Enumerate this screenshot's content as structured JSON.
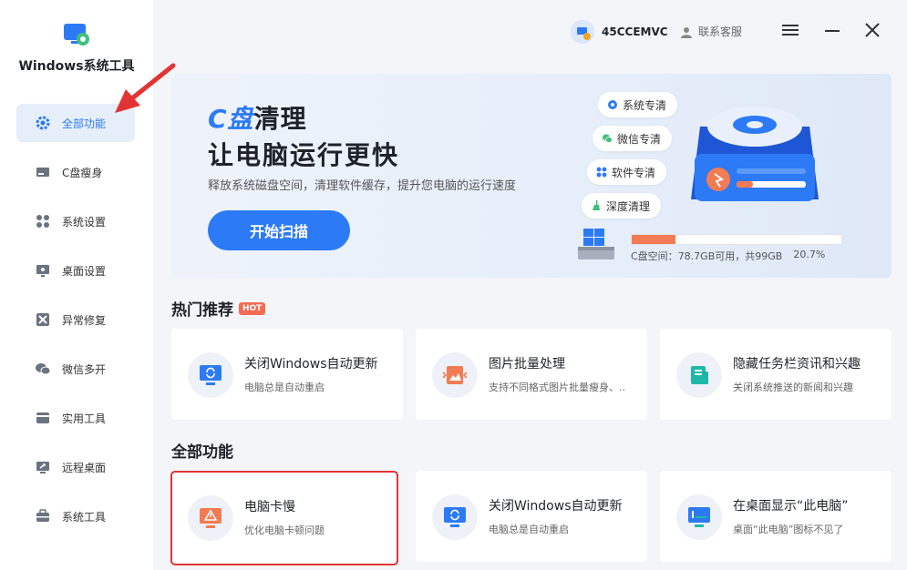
{
  "app": {
    "title": "Windows系统工具"
  },
  "sidebar": {
    "items": [
      {
        "label": "全部功能",
        "icon": "gear-icon",
        "active": true
      },
      {
        "label": "C盘瘦身",
        "icon": "disk-icon"
      },
      {
        "label": "系统设置",
        "icon": "grid-icon"
      },
      {
        "label": "桌面设置",
        "icon": "desktop-icon"
      },
      {
        "label": "异常修复",
        "icon": "tools-icon"
      },
      {
        "label": "微信多开",
        "icon": "wechat-icon"
      },
      {
        "label": "实用工具",
        "icon": "box-icon"
      },
      {
        "label": "远程桌面",
        "icon": "remote-icon"
      },
      {
        "label": "系统工具",
        "icon": "briefcase-icon"
      }
    ]
  },
  "header": {
    "username": "45CCEMVC",
    "service_label": "联系客服"
  },
  "banner": {
    "title_c": "C盘",
    "title_rest": "清理",
    "title_line2": "让电脑运行更快",
    "subtitle": "释放系统磁盘空间，清理软件缓存，提升您电脑的运行速度",
    "button": "开始扫描",
    "pills": [
      "系统专清",
      "微信专清",
      "软件专清",
      "深度清理"
    ],
    "cdrive": {
      "label": "C盘空间：",
      "info": "78.7GB可用，共99GB",
      "percent_text": "20.7%",
      "used_fraction": 0.207
    }
  },
  "hot": {
    "heading": "热门推荐",
    "badge": "HOT",
    "cards": [
      {
        "title": "关闭Windows自动更新",
        "desc": "电脑总是自动重启"
      },
      {
        "title": "图片批量处理",
        "desc": "支持不同格式图片批量瘦身、.."
      },
      {
        "title": "隐藏任务栏资讯和兴趣",
        "desc": "关闭系统推送的新闻和兴趣"
      }
    ]
  },
  "all": {
    "heading": "全部功能",
    "cards": [
      {
        "title": "电脑卡慢",
        "desc": "优化电脑卡顿问题"
      },
      {
        "title": "关闭Windows自动更新",
        "desc": "电脑总是自动重启"
      },
      {
        "title": "在桌面显示“此电脑”",
        "desc": "桌面“此电脑”图标不见了"
      }
    ]
  },
  "colors": {
    "accent": "#2d7af6",
    "warning": "#f27b53",
    "highlight": "#e23434"
  }
}
